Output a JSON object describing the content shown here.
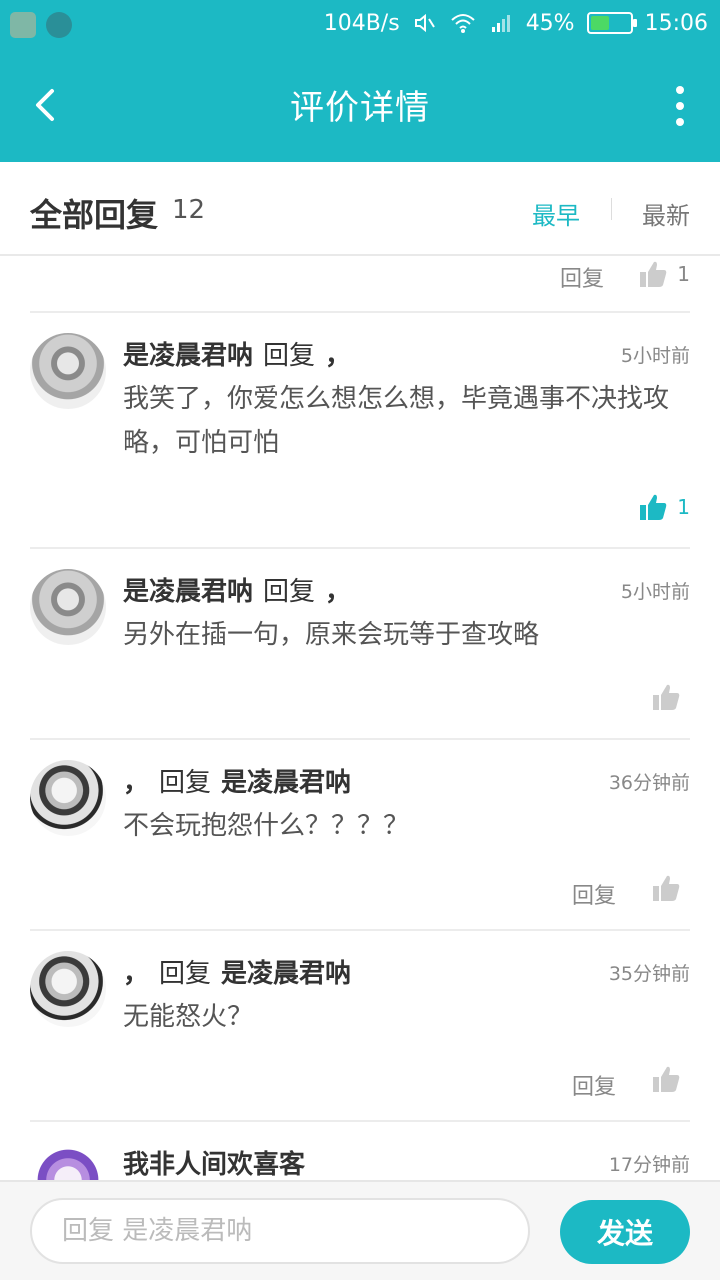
{
  "status_bar": {
    "speed": "104B/s",
    "battery": "45%",
    "time": "15:06"
  },
  "header": {
    "title": "评价详情"
  },
  "subheader": {
    "label": "全部回复",
    "count": "12",
    "sort_earliest": "最早",
    "sort_latest": "最新"
  },
  "partial_row": {
    "reply_label": "回复",
    "like_count": "1"
  },
  "comments": [
    {
      "author": "是凌晨君呐",
      "verb": "回复",
      "target": "，",
      "time": "5小时前",
      "text": "我笑了，你爱怎么想怎么想，毕竟遇事不决找攻略，可怕可怕",
      "like_count": "1"
    },
    {
      "author": "是凌晨君呐",
      "verb": "回复",
      "target": "，",
      "time": "5小时前",
      "text": "另外在插一句，原来会玩等于查攻略"
    },
    {
      "author": "，",
      "verb": "回复",
      "target": "是凌晨君呐",
      "time": "36分钟前",
      "text": "不会玩抱怨什么？？？？",
      "reply_label": "回复"
    },
    {
      "author": "，",
      "verb": "回复",
      "target": "是凌晨君呐",
      "time": "35分钟前",
      "text": "无能怒火？",
      "reply_label": "回复"
    },
    {
      "author": "我非人间欢喜客",
      "time": "17分钟前"
    }
  ],
  "bottom_bar": {
    "placeholder": "回复 是凌晨君呐",
    "send_label": "发送"
  },
  "colors": {
    "accent": "#1cb9c4",
    "like_active": "#1cb9c4",
    "like_inactive": "#cccccc"
  },
  "battery_level": 0.45
}
